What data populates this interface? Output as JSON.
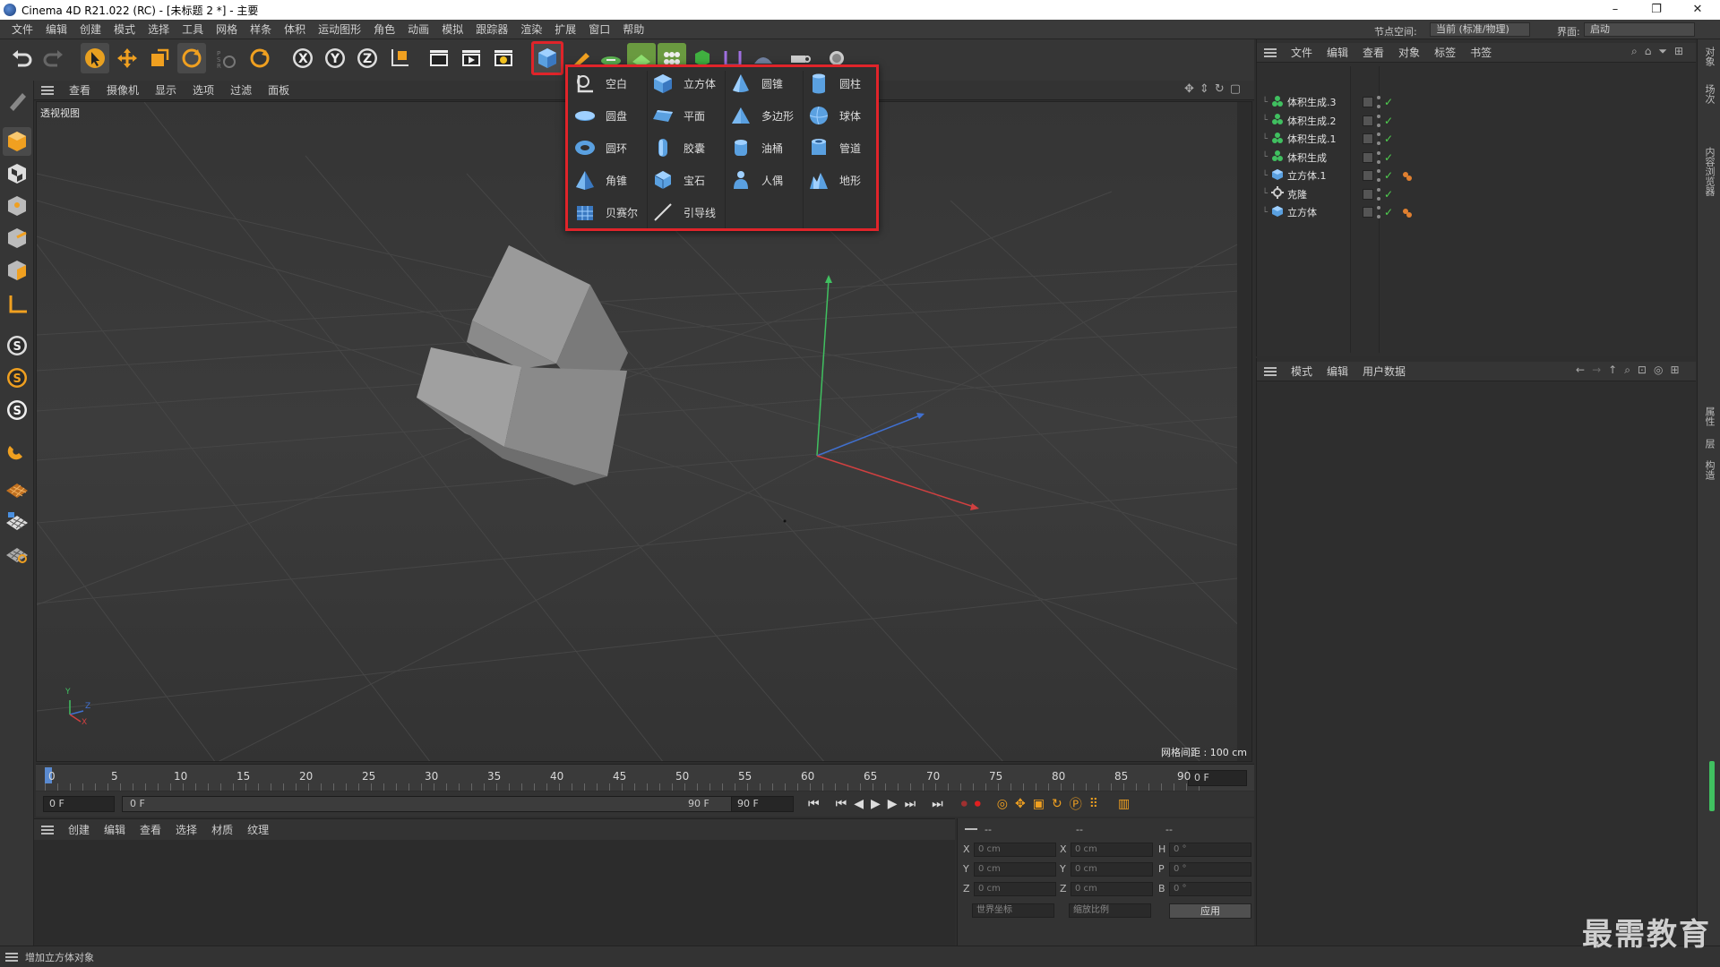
{
  "window": {
    "title": "Cinema 4D R21.022 (RC) - [未标题 2 *] - 主要",
    "min": "–",
    "max": "❐",
    "close": "✕"
  },
  "menubar": {
    "items": [
      "文件",
      "编辑",
      "创建",
      "模式",
      "选择",
      "工具",
      "网格",
      "样条",
      "体积",
      "运动图形",
      "角色",
      "动画",
      "模拟",
      "跟踪器",
      "渲染",
      "扩展",
      "窗口",
      "帮助"
    ],
    "node_space_label": "节点空间:",
    "node_space_value": "当前 (标准/物理)",
    "layout_label": "界面:",
    "layout_value": "启动"
  },
  "viewport": {
    "menu": [
      "查看",
      "摄像机",
      "显示",
      "选项",
      "过滤",
      "面板"
    ],
    "label": "透视视图",
    "grid_spacing": "网格间距 : 100 cm",
    "axis_x": "X",
    "axis_y": "Y",
    "axis_z": "Z"
  },
  "popup": {
    "columns": [
      [
        {
          "label": "空白",
          "icon": "null-icon"
        },
        {
          "label": "圆盘",
          "icon": "disc-icon"
        },
        {
          "label": "圆环",
          "icon": "torus-icon"
        },
        {
          "label": "角锥",
          "icon": "pyramid-icon"
        },
        {
          "label": "贝赛尔",
          "icon": "bezier-icon"
        }
      ],
      [
        {
          "label": "立方体",
          "icon": "cube-icon"
        },
        {
          "label": "平面",
          "icon": "plane-icon"
        },
        {
          "label": "胶囊",
          "icon": "capsule-icon"
        },
        {
          "label": "宝石",
          "icon": "gem-icon"
        },
        {
          "label": "引导线",
          "icon": "guide-icon"
        }
      ],
      [
        {
          "label": "圆锥",
          "icon": "cone-icon"
        },
        {
          "label": "多边形",
          "icon": "polygon-icon"
        },
        {
          "label": "油桶",
          "icon": "oil-tank-icon"
        },
        {
          "label": "人偶",
          "icon": "figure-icon"
        }
      ],
      [
        {
          "label": "圆柱",
          "icon": "cylinder-icon"
        },
        {
          "label": "球体",
          "icon": "sphere-icon"
        },
        {
          "label": "管道",
          "icon": "tube-icon"
        },
        {
          "label": "地形",
          "icon": "landscape-icon"
        }
      ]
    ]
  },
  "timeline": {
    "ticks": [
      "0",
      "5",
      "10",
      "15",
      "20",
      "25",
      "30",
      "35",
      "40",
      "45",
      "50",
      "55",
      "60",
      "65",
      "70",
      "75",
      "80",
      "85",
      "90"
    ],
    "current_frame": "0 F",
    "start": "0 F",
    "range_start": "0 F",
    "range_end": "90 F",
    "end": "90 F"
  },
  "material": {
    "menu": [
      "创建",
      "编辑",
      "查看",
      "选择",
      "材质",
      "纹理"
    ]
  },
  "coords": {
    "header": [
      "--",
      "--",
      "--"
    ],
    "rows": [
      {
        "a": "X",
        "av": "0 cm",
        "b": "X",
        "bv": "0 cm",
        "c": "H",
        "cv": "0 °"
      },
      {
        "a": "Y",
        "av": "0 cm",
        "b": "Y",
        "bv": "0 cm",
        "c": "P",
        "cv": "0 °"
      },
      {
        "a": "Z",
        "av": "0 cm",
        "b": "Z",
        "bv": "0 cm",
        "c": "B",
        "cv": "0 °"
      }
    ],
    "world": "世界坐标",
    "scale": "缩放比例",
    "apply": "应用"
  },
  "objects": {
    "menu": [
      "文件",
      "编辑",
      "查看",
      "对象",
      "标签",
      "书签"
    ],
    "items": [
      {
        "name": "体积生成.3",
        "type": "volume-builder-icon",
        "tag": false
      },
      {
        "name": "体积生成.2",
        "type": "volume-builder-icon",
        "tag": false
      },
      {
        "name": "体积生成.1",
        "type": "volume-builder-icon",
        "tag": false
      },
      {
        "name": "体积生成",
        "type": "volume-builder-icon",
        "tag": false
      },
      {
        "name": "立方体.1",
        "type": "cube-icon",
        "tag": true
      },
      {
        "name": "克隆",
        "type": "cloner-icon",
        "tag": false
      },
      {
        "name": "立方体",
        "type": "cube-icon",
        "tag": true
      }
    ]
  },
  "attributes": {
    "menu": [
      "模式",
      "编辑",
      "用户数据"
    ]
  },
  "right_tabs": [
    "对象",
    "场次",
    "内容浏览器",
    "属性",
    "层",
    "构造"
  ],
  "status": "增加立方体对象",
  "watermark": "最需教育",
  "colors": {
    "highlight": "#e0242a",
    "accent_orange": "#f0a020",
    "axis_x": "#d04040",
    "axis_y": "#40c060",
    "axis_z": "#4070d0"
  }
}
